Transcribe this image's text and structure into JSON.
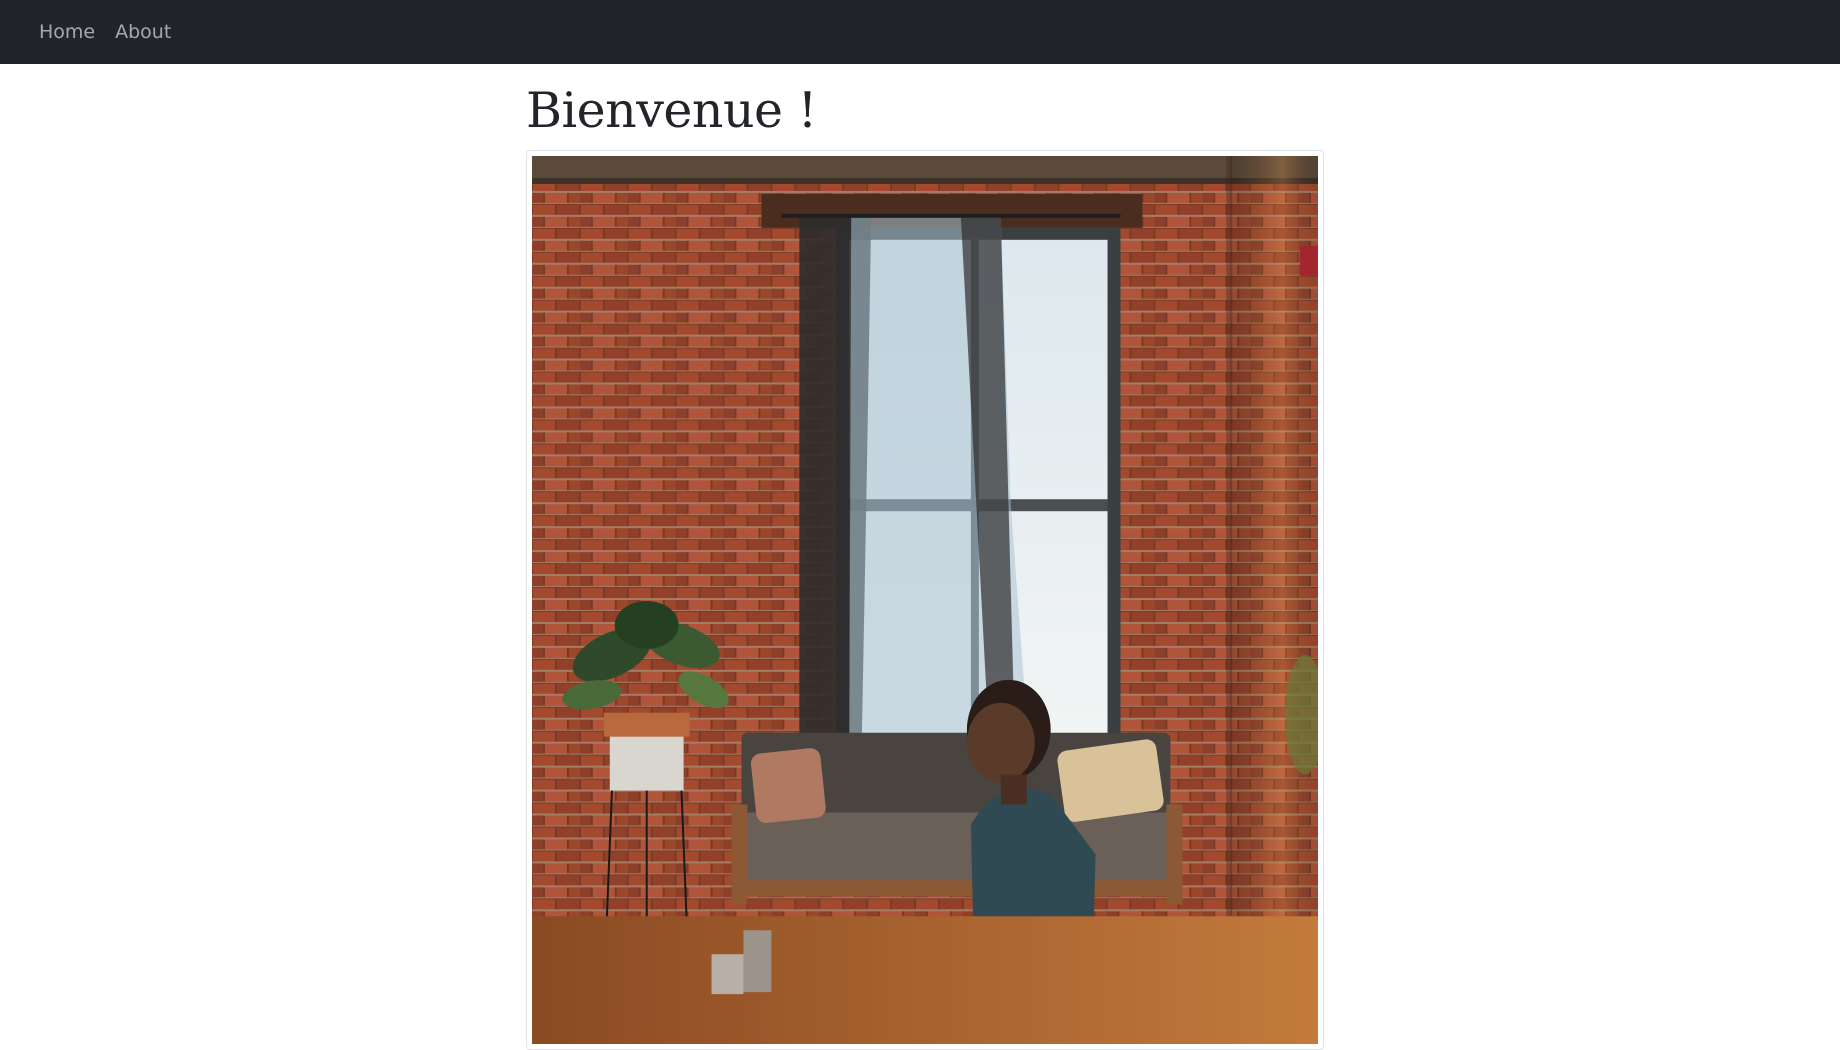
{
  "navbar": {
    "items": [
      {
        "label": "Home"
      },
      {
        "label": "About"
      }
    ]
  },
  "main": {
    "title": "Bienvenue !"
  },
  "colors": {
    "navbar_bg": "#212529",
    "nav_text": "#9ea0a2",
    "title_text": "#212529",
    "brick": "#8b3a22",
    "floor": "#b0652a"
  }
}
